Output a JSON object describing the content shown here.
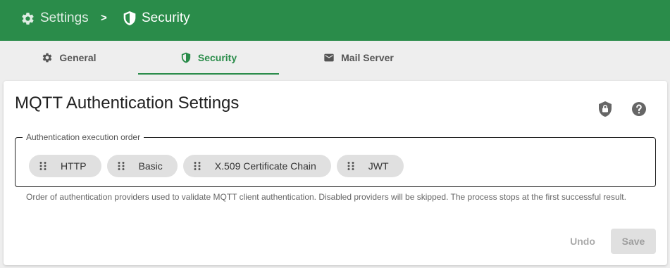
{
  "header": {
    "breadcrumb": {
      "root_label": "Settings",
      "root_icon": "gear-icon",
      "separator": ">",
      "current_label": "Security",
      "current_icon": "shield-check-icon"
    },
    "bg_color": "#2a8c4a"
  },
  "tabs": [
    {
      "label": "General",
      "icon": "gear-icon",
      "active": false
    },
    {
      "label": "Security",
      "icon": "shield-check-icon",
      "active": true
    },
    {
      "label": "Mail Server",
      "icon": "mail-icon",
      "active": false
    }
  ],
  "card": {
    "title": "MQTT Authentication Settings",
    "header_icons": [
      "lock-shield-icon",
      "help-icon"
    ],
    "order_field": {
      "legend": "Authentication execution order",
      "chips": [
        {
          "label": "HTTP"
        },
        {
          "label": "Basic"
        },
        {
          "label": "X.509 Certificate Chain"
        },
        {
          "label": "JWT"
        }
      ]
    },
    "hint": "Order of authentication providers used to validate MQTT client authentication. Disabled providers will be skipped. The process stops at the first successful result.",
    "buttons": {
      "undo": "Undo",
      "save": "Save"
    }
  },
  "colors": {
    "accent": "#2a8c4a",
    "chip_bg": "#e0e0e0",
    "disabled_text": "#9e9e9e"
  }
}
